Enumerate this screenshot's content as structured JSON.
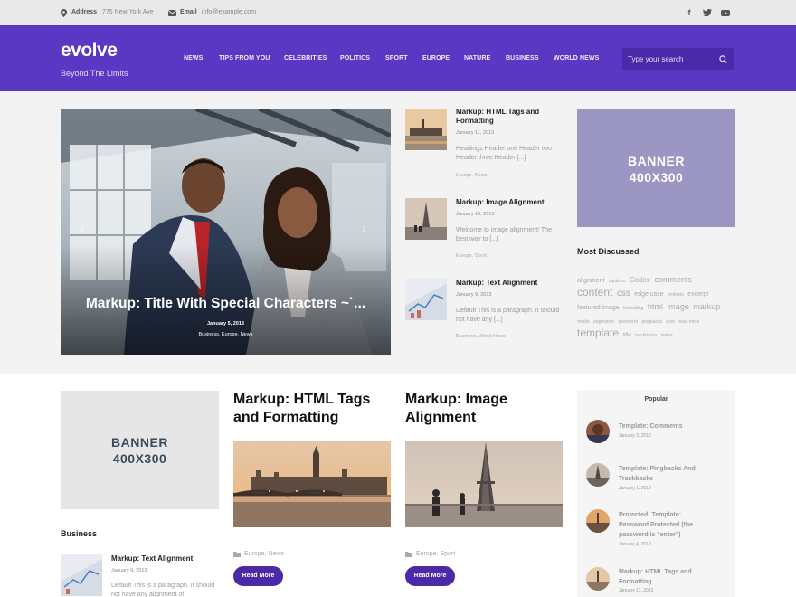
{
  "topbar": {
    "address_label": "Address",
    "address_value": "775 New York Ave",
    "email_label": "Email",
    "email_value": "info@example.com",
    "social": [
      {
        "icon": "facebook-icon",
        "glyph": "f"
      },
      {
        "icon": "twitter-icon",
        "glyph": "t"
      },
      {
        "icon": "youtube-icon",
        "glyph": "▶"
      }
    ]
  },
  "header": {
    "logo": "evolve",
    "tagline": "Beyond The Limits",
    "nav": [
      "NEWS",
      "TIPS FROM YOU",
      "CELEBRITIES",
      "POLITICS",
      "SPORT",
      "EUROPE",
      "NATURE",
      "BUSINESS",
      "WORLD NEWS"
    ],
    "search_placeholder": "Type your search"
  },
  "slider": {
    "title": "Markup: Title With Special Characters ~`...",
    "date": "January 5, 2013",
    "cats": "Business, Europe, News"
  },
  "recent_posts": [
    {
      "title": "Markup: HTML Tags and Formatting",
      "date": "January 11, 2013",
      "excerpt": "Headings Header one Header two Header three Header [...]",
      "cats": "Europe, News"
    },
    {
      "title": "Markup: Image Alignment",
      "date": "January 10, 2013",
      "excerpt": "Welcome to image alignment! The best way to [...]",
      "cats": "Europe, Sport"
    },
    {
      "title": "Markup: Text Alignment",
      "date": "January 9, 2013",
      "excerpt": "Default This is a paragraph. It should not have any [...]",
      "cats": "Business, World News"
    }
  ],
  "banner": {
    "line1": "BANNER",
    "line2": "400X300"
  },
  "most_discussed": {
    "title": "Most Discussed",
    "tags": [
      "alignment",
      "captions",
      "Codex",
      "comments",
      "content",
      "css",
      "edge case",
      "embeds",
      "excerpt",
      "featured image",
      "formatting",
      "html",
      "image",
      "markup",
      "media",
      "pagination",
      "password",
      "pingbacks",
      "post",
      "read more",
      "template",
      "title",
      "trackbacks",
      "twitter"
    ]
  },
  "business": {
    "title": "Business",
    "post": {
      "title": "Markup: Text Alignment",
      "date": "January 9, 2013",
      "excerpt": "Default This is a paragraph. It should not have any alignment of"
    }
  },
  "featured": [
    {
      "title": "Markup: HTML Tags and Formatting",
      "cats": "Europe, News",
      "button": "Read More"
    },
    {
      "title": "Markup: Image Alignment",
      "cats": "Europe, Sport",
      "button": "Read More"
    }
  ],
  "popular": {
    "title": "Popular",
    "items": [
      {
        "title": "Template: Comments",
        "date": "January 3, 2012"
      },
      {
        "title": "Template: Pingbacks And Trackbacks",
        "date": "January 1, 2012"
      },
      {
        "title": "Protected: Template: Password Protected (the password is \"enter\")",
        "date": "January 4, 2012"
      },
      {
        "title": "Markup: HTML Tags and Formatting",
        "date": "January 11, 2013"
      }
    ]
  },
  "colors": {
    "brand": "#5a38c4",
    "button": "#4a2aa8",
    "banner_purple": "#9b97c2",
    "banner_text": "#3c4a5e"
  }
}
